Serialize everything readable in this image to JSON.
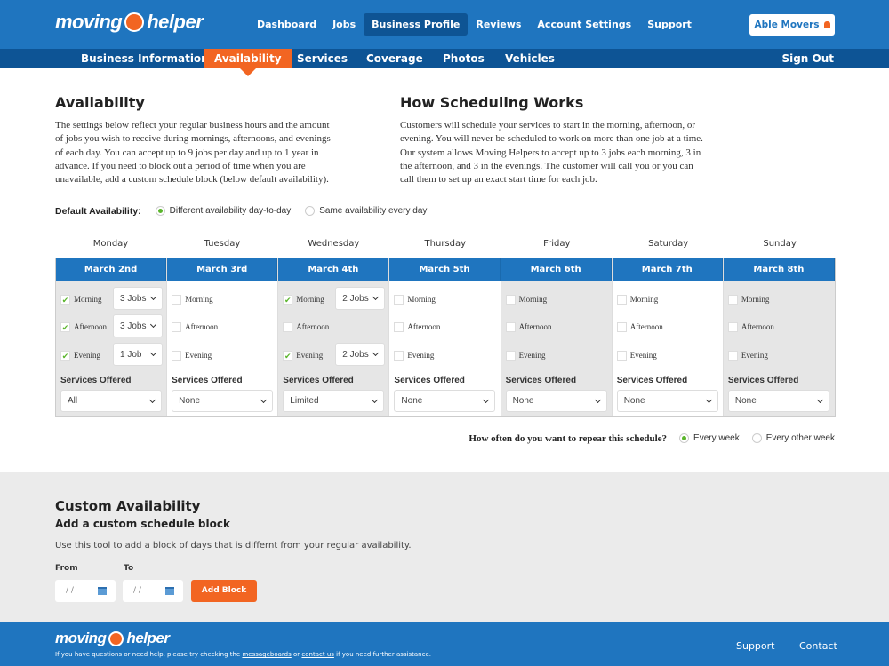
{
  "brand": {
    "logo_text_left": "moving",
    "logo_text_right": "helper",
    "accent": "#f26522",
    "primary": "#1f75bf"
  },
  "nav": {
    "items": [
      {
        "label": "Dashboard"
      },
      {
        "label": "Jobs"
      },
      {
        "label": "Business Profile",
        "active": true
      },
      {
        "label": "Reviews"
      },
      {
        "label": "Account Settings"
      },
      {
        "label": "Support"
      }
    ],
    "account": "Able Movers",
    "account_icon": "lock-icon"
  },
  "subnav": {
    "items": [
      {
        "label": "Business Information"
      },
      {
        "label": "Availability",
        "active": true
      },
      {
        "label": "Services"
      },
      {
        "label": "Coverage"
      },
      {
        "label": "Photos"
      },
      {
        "label": "Vehicles"
      }
    ],
    "sign_out": "Sign Out"
  },
  "availability": {
    "title": "Availability",
    "text": "The settings below reflect your regular business hours and the amount of jobs you wish to receive during mornings, afternoons, and evenings of each day. You can accept up to 9 jobs per day and up to 1 year in advance. If you need to block out a period of time when you are unavailable, add a custom schedule block (below default availability)."
  },
  "how": {
    "title": "How Scheduling Works",
    "text": "Customers will schedule your services to start in the morning, afternoon, or evening. You will never be scheduled to work on more than one job at a time. Our system allows Moving Helpers to accept up to 3 jobs each morning, 3 in the afternoon, and 3 in the evenings. The customer will call you or you can call them to set up an exact start time for each job."
  },
  "default_availability": {
    "label": "Default Availability:",
    "options": [
      {
        "label": "Different availability day-to-day",
        "selected": true
      },
      {
        "label": "Same availability every day",
        "selected": false
      }
    ]
  },
  "slot_labels": [
    "Morning",
    "Afternoon",
    "Evening"
  ],
  "services_label": "Services Offered",
  "days": [
    {
      "day": "Monday",
      "date": "March 2nd",
      "slots": [
        {
          "checked": true,
          "jobs": "3 Jobs"
        },
        {
          "checked": true,
          "jobs": "3 Jobs"
        },
        {
          "checked": true,
          "jobs": "1 Job"
        }
      ],
      "services": "All"
    },
    {
      "day": "Tuesday",
      "date": "March 3rd",
      "slots": [
        {
          "checked": false
        },
        {
          "checked": false
        },
        {
          "checked": false
        }
      ],
      "services": "None"
    },
    {
      "day": "Wednesday",
      "date": "March 4th",
      "slots": [
        {
          "checked": true,
          "jobs": "2 Jobs"
        },
        {
          "checked": false
        },
        {
          "checked": true,
          "jobs": "2 Jobs"
        }
      ],
      "services": "Limited"
    },
    {
      "day": "Thursday",
      "date": "March 5th",
      "slots": [
        {
          "checked": false
        },
        {
          "checked": false
        },
        {
          "checked": false
        }
      ],
      "services": "None"
    },
    {
      "day": "Friday",
      "date": "March 6th",
      "slots": [
        {
          "checked": false
        },
        {
          "checked": false
        },
        {
          "checked": false
        }
      ],
      "services": "None"
    },
    {
      "day": "Saturday",
      "date": "March 7th",
      "slots": [
        {
          "checked": false
        },
        {
          "checked": false
        },
        {
          "checked": false
        }
      ],
      "services": "None"
    },
    {
      "day": "Sunday",
      "date": "March 8th",
      "slots": [
        {
          "checked": false
        },
        {
          "checked": false
        },
        {
          "checked": false
        }
      ],
      "services": "None"
    }
  ],
  "repeat": {
    "question": "How often do you want to repear this schedule?",
    "options": [
      {
        "label": "Every week",
        "selected": true
      },
      {
        "label": "Every other week",
        "selected": false
      }
    ]
  },
  "custom": {
    "title": "Custom Availability",
    "subtitle": "Add a custom schedule block",
    "text": "Use this tool to add a block of days that is differnt from your regular availability.",
    "from_label": "From",
    "to_label": "To",
    "from_value": "/ /",
    "to_value": "/ /",
    "button": "Add Block"
  },
  "footer": {
    "note_1": "If you have questions or need help, please try checking the ",
    "link_1": "messageboards",
    "note_2": " or ",
    "link_2": "contact us",
    "note_3": " if you need further assistance.",
    "support": "Support",
    "contact": "Contact"
  }
}
